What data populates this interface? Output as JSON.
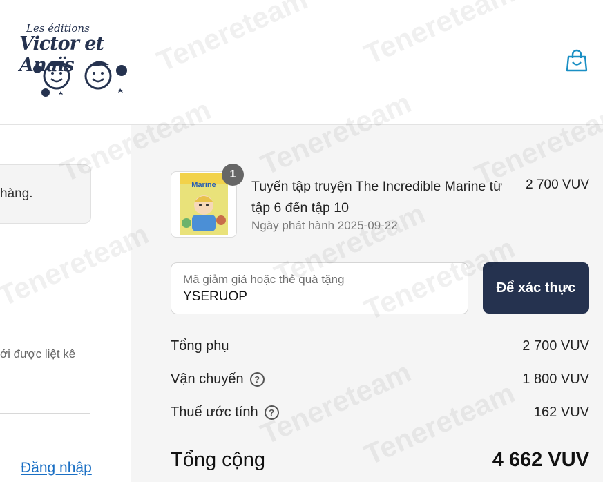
{
  "header": {
    "logo": {
      "line1": "Les éditions",
      "line2": "Victor et Anaïs"
    },
    "cart_icon": "shopping-bag-icon"
  },
  "left_panel": {
    "notice_text": "hàng.",
    "muted_text": "ới được liệt kê",
    "login_link": "Đăng nhập"
  },
  "order": {
    "item": {
      "quantity": "1",
      "title": "Tuyển tập truyện The Incredible Marine từ tập 6 đến tập 10",
      "release_date": "Ngày phát hành 2025-09-22",
      "price": "2 700 VUV",
      "cover_title": "Marine"
    },
    "discount": {
      "label": "Mã giảm giá hoặc thẻ quà tặng",
      "value": "YSERUOP",
      "apply_label": "Để xác thực"
    },
    "summary": {
      "subtotal_label": "Tổng phụ",
      "subtotal_value": "2 700 VUV",
      "shipping_label": "Vận chuyển",
      "shipping_value": "1 800 VUV",
      "tax_label": "Thuế ước tính",
      "tax_value": "162 VUV",
      "help_glyph": "?"
    },
    "total": {
      "label": "Tổng cộng",
      "value": "4 662 VUV"
    }
  },
  "watermark": "Tenereteam",
  "colors": {
    "accent": "#25324f",
    "link": "#1a6fc4",
    "panel": "#f5f5f5"
  }
}
